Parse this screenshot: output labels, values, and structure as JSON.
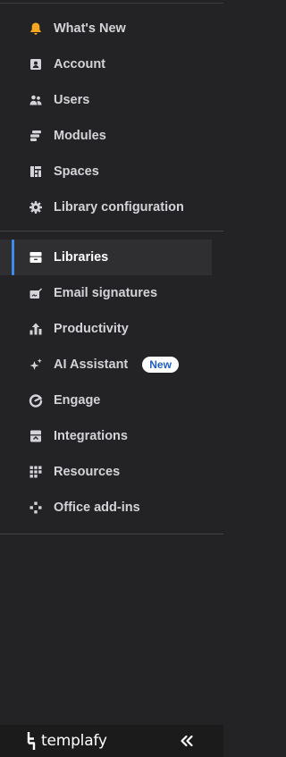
{
  "nav_top": [
    {
      "label": "What's New",
      "icon": "bell-icon"
    },
    {
      "label": "Account",
      "icon": "account-icon"
    },
    {
      "label": "Users",
      "icon": "users-icon"
    },
    {
      "label": "Modules",
      "icon": "modules-icon"
    },
    {
      "label": "Spaces",
      "icon": "spaces-icon"
    },
    {
      "label": "Library configuration",
      "icon": "gear-icon"
    }
  ],
  "nav_main": [
    {
      "label": "Libraries",
      "icon": "libraries-icon",
      "active": true
    },
    {
      "label": "Email signatures",
      "icon": "signature-icon"
    },
    {
      "label": "Productivity",
      "icon": "productivity-icon"
    },
    {
      "label": "AI Assistant",
      "icon": "sparkle-icon",
      "badge": "New"
    },
    {
      "label": "Engage",
      "icon": "engage-icon"
    },
    {
      "label": "Integrations",
      "icon": "integrations-icon"
    },
    {
      "label": "Resources",
      "icon": "grid-icon"
    },
    {
      "label": "Office add-ins",
      "icon": "addins-icon"
    }
  ],
  "footer": {
    "brand": "templafy",
    "collapse_icon": "double-chevron-left-icon"
  },
  "colors": {
    "background": "#232325",
    "accent": "#3e8bf0",
    "bell": "#f5a623",
    "badge_text": "#1d5fc4"
  }
}
